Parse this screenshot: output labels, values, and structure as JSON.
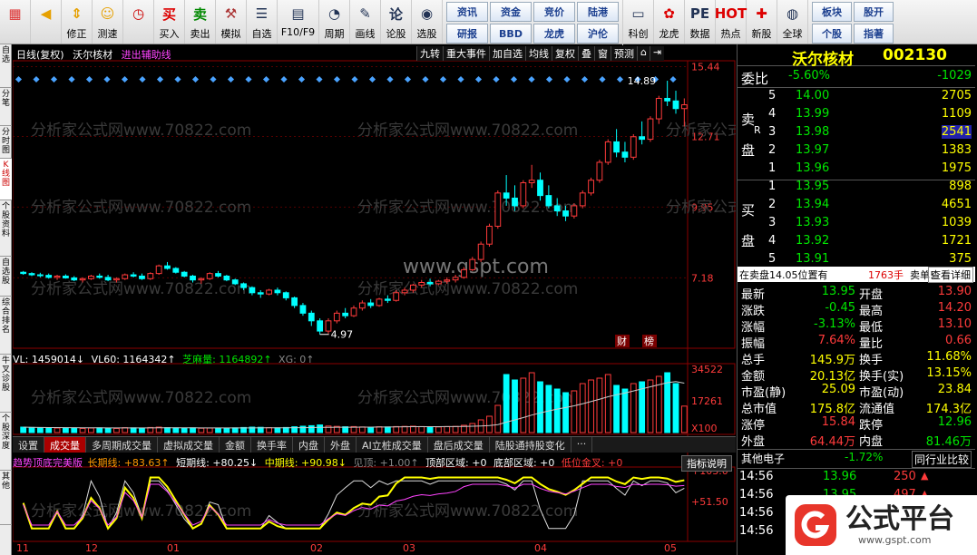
{
  "toolbar": {
    "buttons": [
      {
        "label": "",
        "icon": "grid-icon"
      },
      {
        "label": "",
        "icon": "back-arrow-icon"
      },
      {
        "label": "修正",
        "icon": "updown-icon"
      },
      {
        "label": "测速",
        "icon": "smile-icon"
      },
      {
        "label": "",
        "icon": "clock-icon"
      },
      {
        "label": "买入",
        "icon": "buy-icon",
        "glyph": "买"
      },
      {
        "label": "卖出",
        "icon": "sell-icon",
        "glyph": "卖"
      },
      {
        "label": "模拟",
        "icon": "hammer-icon"
      },
      {
        "label": "自选",
        "icon": "star-list-icon"
      },
      {
        "label": "F10/F9",
        "icon": "info-icon"
      },
      {
        "label": "周期",
        "icon": "cycle-icon"
      },
      {
        "label": "画线",
        "icon": "pencil-icon"
      },
      {
        "label": "论股",
        "icon": "talk-icon",
        "glyph": "论"
      },
      {
        "label": "选股",
        "icon": "chart-icon"
      }
    ],
    "grid": [
      "资讯",
      "资金",
      "竞价",
      "陆港",
      "研报",
      "BBD",
      "龙虎",
      "沪伦"
    ],
    "buttons2": [
      {
        "label": "科创",
        "icon": "cards-icon"
      },
      {
        "label": "龙虎",
        "icon": "dragon-icon"
      },
      {
        "label": "数据",
        "icon": "pe-icon",
        "glyph": "PE"
      },
      {
        "label": "热点",
        "icon": "hot-icon",
        "glyph": "HOT"
      },
      {
        "label": "新股",
        "icon": "new-icon"
      },
      {
        "label": "全球",
        "icon": "globe-icon"
      }
    ],
    "grid2": [
      "板块",
      "股开",
      "个股",
      "指著"
    ]
  },
  "left_tabs": [
    "自选",
    "分笔",
    "分时图",
    "K线图",
    "个股资料",
    "自选股",
    "综合排名",
    "牛叉诊股",
    "个股深度",
    "其他"
  ],
  "chart_header": {
    "period": "日线(复权)",
    "stock": "沃尔核材",
    "indicator": "进出辅助线",
    "right_buttons": [
      "九转",
      "重大事件",
      "加自选",
      "均线",
      "复权",
      "叠",
      "窗",
      "预测"
    ],
    "price_ticks": [
      "15.44",
      "12.71",
      "9.95",
      "7.18"
    ],
    "high_label": "14.89",
    "low_label": "4.97",
    "badges": [
      "财",
      "榜"
    ]
  },
  "volume_header": {
    "vl": "VL: 1459014↓",
    "vl60": "VL60: 1164342↑",
    "zhima": "芝麻量: 1164892↑",
    "xg": "XG: 0↑",
    "ticks": [
      "34522",
      "17261",
      "X100"
    ]
  },
  "tabs": [
    "设置",
    "成交量",
    "多周期成交量",
    "虚拟成交量",
    "金额",
    "换手率",
    "内盘",
    "外盘",
    "AI立桩成交量",
    "盘后成交量",
    "陆股通持股变化",
    "···"
  ],
  "tabs_active": 1,
  "indicator_btn": "指标说明",
  "lower_header": {
    "name": "趋势顶底完美版",
    "long": "长期线: +83.63↑",
    "short": "短期线: +80.25↓",
    "mid": "中期线: +90.98↓",
    "see": "见顶: +1.00↑",
    "top": "顶部区域: +0",
    "bottom": "底部区域: +0",
    "golden": "低位金叉: +0",
    "ticks": [
      "+103.0",
      "+51.50"
    ]
  },
  "x_axis": [
    "11",
    "12",
    "01",
    "02",
    "03",
    "04",
    "05"
  ],
  "quote": {
    "name": "沃尔核材",
    "code": "002130",
    "weibi_label": "委比",
    "weibi": "-5.60%",
    "weicha": "-1029",
    "sell_label1": "卖",
    "sell_label2": "盘",
    "buy_label1": "买",
    "buy_label2": "盘",
    "sells": [
      {
        "lv": "5",
        "p": "14.00",
        "v": "2705"
      },
      {
        "lv": "4",
        "p": "13.99",
        "v": "1109"
      },
      {
        "lv": "3",
        "p": "13.98",
        "v": "2541"
      },
      {
        "lv": "2",
        "p": "13.97",
        "v": "1383"
      },
      {
        "lv": "1",
        "p": "13.96",
        "v": "1975"
      }
    ],
    "buys": [
      {
        "lv": "1",
        "p": "13.95",
        "v": "898"
      },
      {
        "lv": "2",
        "p": "13.94",
        "v": "4651"
      },
      {
        "lv": "3",
        "p": "13.93",
        "v": "1039"
      },
      {
        "lv": "4",
        "p": "13.92",
        "v": "1721"
      },
      {
        "lv": "5",
        "p": "13.91",
        "v": "375"
      }
    ],
    "r_label": "R",
    "msg": "在卖盘14.05位置有",
    "msg_vol": "1763手",
    "msg_tail": "卖单!",
    "detail_btn": "查看详细",
    "stats": [
      [
        "最新",
        "13.95",
        "开盘",
        "13.90"
      ],
      [
        "涨跌",
        "-0.45",
        "最高",
        "14.20"
      ],
      [
        "涨幅",
        "-3.13%",
        "最低",
        "13.10"
      ],
      [
        "振幅",
        "7.64%",
        "量比",
        "0.66"
      ],
      [
        "总手",
        "145.9万",
        "换手",
        "11.68%"
      ],
      [
        "金额",
        "20.13亿",
        "换手(实)",
        "13.15%"
      ],
      [
        "市盈(静)",
        "25.09",
        "市盈(动)",
        "23.84"
      ],
      [
        "总市值",
        "175.8亿",
        "流通值",
        "174.3亿"
      ],
      [
        "涨停",
        "15.84",
        "跌停",
        "12.96"
      ],
      [
        "外盘",
        "64.44万",
        "内盘",
        "81.46万"
      ]
    ],
    "sector": "其他电子",
    "sector_pct": "-1.72%",
    "compare_btn": "同行业比较",
    "ticks": [
      {
        "t": "14:56",
        "p": "13.96",
        "v": "250"
      },
      {
        "t": "14:56",
        "p": "13.95",
        "v": "497"
      },
      {
        "t": "14:56",
        "p": "",
        "v": ""
      },
      {
        "t": "14:56",
        "p": "",
        "v": ""
      }
    ]
  },
  "watermarks": [
    "www.gspt.com",
    "分析家公式网www.70822.com"
  ],
  "logo": {
    "text": "公式平台",
    "url": "www.gspt.com"
  },
  "chart_data": {
    "type": "candlestick",
    "title": "沃尔核材 日线(复权)",
    "ylim": [
      4.5,
      15.6
    ],
    "candles": [
      [
        7.4,
        7.45,
        7.3,
        7.35
      ],
      [
        7.35,
        7.4,
        7.25,
        7.3
      ],
      [
        7.3,
        7.38,
        7.2,
        7.28
      ],
      [
        7.28,
        7.35,
        7.15,
        7.2
      ],
      [
        7.2,
        7.3,
        7.1,
        7.25
      ],
      [
        7.25,
        7.32,
        7.15,
        7.18
      ],
      [
        7.18,
        7.25,
        7.05,
        7.1
      ],
      [
        7.1,
        7.2,
        7.0,
        7.15
      ],
      [
        7.15,
        7.3,
        7.1,
        7.25
      ],
      [
        7.25,
        7.35,
        7.15,
        7.2
      ],
      [
        7.2,
        7.3,
        7.05,
        7.1
      ],
      [
        7.1,
        7.2,
        7.0,
        7.15
      ],
      [
        7.15,
        7.35,
        7.1,
        7.3
      ],
      [
        7.3,
        7.4,
        7.2,
        7.25
      ],
      [
        7.25,
        7.35,
        7.1,
        7.15
      ],
      [
        7.15,
        7.4,
        7.1,
        7.35
      ],
      [
        7.35,
        7.7,
        7.3,
        7.65
      ],
      [
        7.65,
        7.8,
        7.5,
        7.55
      ],
      [
        7.55,
        7.6,
        7.35,
        7.4
      ],
      [
        7.4,
        7.45,
        7.2,
        7.25
      ],
      [
        7.25,
        7.3,
        7.0,
        7.1
      ],
      [
        7.1,
        7.2,
        6.95,
        7.15
      ],
      [
        7.15,
        7.4,
        7.1,
        7.35
      ],
      [
        7.35,
        7.45,
        7.2,
        7.25
      ],
      [
        7.25,
        7.3,
        7.05,
        7.1
      ],
      [
        7.1,
        7.15,
        6.9,
        6.95
      ],
      [
        6.95,
        7.0,
        6.7,
        6.8
      ],
      [
        6.8,
        6.85,
        6.5,
        6.6
      ],
      [
        6.6,
        6.7,
        6.4,
        6.55
      ],
      [
        6.55,
        6.75,
        6.5,
        6.7
      ],
      [
        6.7,
        6.8,
        6.5,
        6.6
      ],
      [
        6.6,
        6.65,
        6.3,
        6.4
      ],
      [
        6.4,
        6.45,
        6.0,
        6.1
      ],
      [
        6.1,
        6.2,
        5.7,
        5.8
      ],
      [
        5.8,
        5.9,
        5.3,
        5.5
      ],
      [
        5.5,
        5.6,
        4.97,
        5.1
      ],
      [
        5.1,
        5.6,
        5.0,
        5.5
      ],
      [
        5.5,
        5.9,
        5.4,
        5.8
      ],
      [
        5.8,
        6.0,
        5.6,
        5.7
      ],
      [
        5.7,
        6.1,
        5.65,
        6.0
      ],
      [
        6.0,
        6.3,
        5.9,
        6.2
      ],
      [
        6.2,
        6.35,
        6.0,
        6.1
      ],
      [
        6.1,
        6.4,
        6.05,
        6.35
      ],
      [
        6.35,
        6.5,
        6.2,
        6.3
      ],
      [
        6.3,
        6.7,
        6.25,
        6.6
      ],
      [
        6.6,
        6.8,
        6.5,
        6.7
      ],
      [
        6.7,
        6.95,
        6.6,
        6.9
      ],
      [
        6.9,
        7.1,
        6.8,
        7.0
      ],
      [
        7.0,
        7.15,
        6.85,
        6.95
      ],
      [
        6.95,
        7.1,
        6.9,
        7.05
      ],
      [
        7.05,
        7.2,
        6.95,
        7.1
      ],
      [
        7.1,
        7.3,
        7.0,
        7.2
      ],
      [
        7.2,
        7.6,
        7.15,
        7.5
      ],
      [
        7.5,
        8.0,
        7.45,
        7.9
      ],
      [
        7.9,
        8.6,
        7.8,
        8.5
      ],
      [
        8.5,
        9.3,
        8.4,
        9.2
      ],
      [
        9.2,
        10.6,
        9.1,
        10.5
      ],
      [
        10.5,
        11.2,
        10.0,
        10.3
      ],
      [
        10.3,
        10.8,
        9.8,
        10.0
      ],
      [
        10.0,
        11.0,
        9.9,
        10.9
      ],
      [
        10.9,
        11.6,
        10.7,
        11.0
      ],
      [
        11.0,
        11.3,
        10.2,
        10.4
      ],
      [
        10.4,
        10.8,
        9.9,
        10.0
      ],
      [
        10.0,
        10.3,
        9.6,
        9.8
      ],
      [
        9.8,
        10.0,
        9.4,
        9.6
      ],
      [
        9.6,
        10.1,
        9.5,
        10.0
      ],
      [
        10.0,
        10.6,
        9.9,
        10.5
      ],
      [
        10.5,
        11.1,
        10.4,
        11.0
      ],
      [
        11.0,
        11.8,
        10.9,
        11.7
      ],
      [
        11.7,
        12.6,
        11.6,
        12.5
      ],
      [
        12.5,
        13.0,
        11.9,
        12.1
      ],
      [
        12.1,
        12.5,
        11.7,
        11.9
      ],
      [
        11.9,
        12.8,
        11.8,
        12.7
      ],
      [
        12.7,
        13.3,
        12.4,
        12.6
      ],
      [
        12.6,
        13.5,
        12.5,
        13.4
      ],
      [
        13.4,
        14.3,
        13.2,
        14.2
      ],
      [
        14.2,
        14.89,
        13.9,
        14.1
      ],
      [
        14.1,
        14.5,
        13.6,
        13.8
      ],
      [
        13.8,
        14.2,
        13.1,
        13.95
      ]
    ],
    "volume": [
      300,
      280,
      260,
      270,
      250,
      260,
      240,
      230,
      250,
      260,
      240,
      230,
      270,
      260,
      250,
      280,
      300,
      270,
      260,
      250,
      260,
      240,
      250,
      240,
      230,
      260,
      280,
      300,
      290,
      270,
      260,
      280,
      320,
      350,
      380,
      420,
      360,
      340,
      320,
      330,
      310,
      300,
      320,
      310,
      330,
      340,
      350,
      330,
      320,
      310,
      330,
      340,
      400,
      500,
      700,
      900,
      1500,
      3200,
      2900,
      3000,
      3300,
      2800,
      2600,
      2400,
      2200,
      2300,
      2700,
      2900,
      3000,
      3200,
      2600,
      2400,
      2700,
      2800,
      2900,
      3100,
      3300,
      2700,
      1459
    ]
  }
}
